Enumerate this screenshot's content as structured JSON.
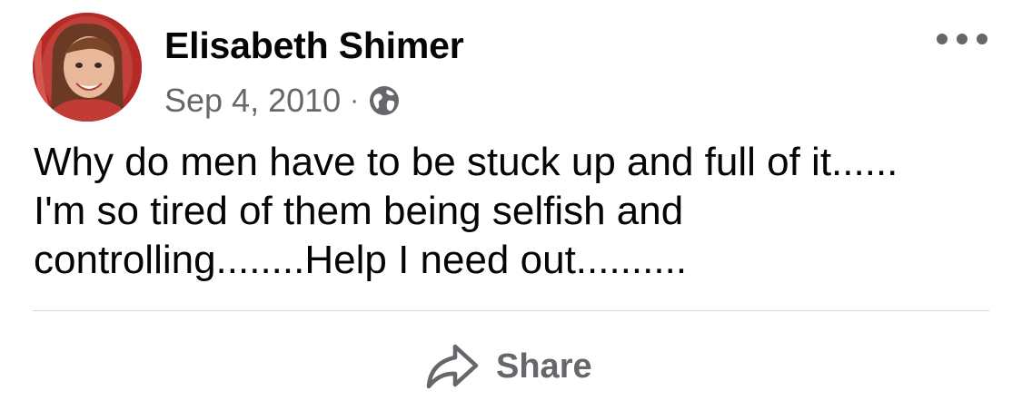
{
  "post": {
    "author_name": "Elisabeth Shimer",
    "date": "Sep 4, 2010",
    "separator": "·",
    "privacy_icon": "globe-icon",
    "more_icon": "more-horizontal-icon",
    "text": "Why do men have to be stuck up and full of it......\nI'm so tired of them being selfish and\ncontrolling........Help I need out..........",
    "actions": {
      "share_label": "Share",
      "share_icon": "share-arrow-icon"
    }
  },
  "colors": {
    "primary_text": "#050505",
    "secondary_text": "#65676b",
    "divider": "#d8dadf",
    "background": "#ffffff"
  }
}
